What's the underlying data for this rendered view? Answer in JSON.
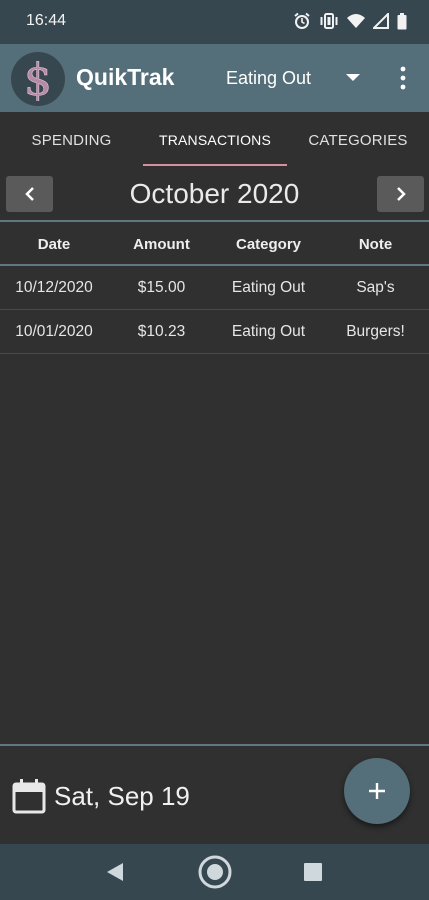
{
  "status_bar": {
    "time": "16:44"
  },
  "app_bar": {
    "title": "QuikTrak",
    "selected_category": "Eating Out"
  },
  "tabs": [
    {
      "label": "SPENDING",
      "active": false
    },
    {
      "label": "TRANSACTIONS",
      "active": true
    },
    {
      "label": "CATEGORIES",
      "active": false
    }
  ],
  "month_nav": {
    "month": "October 2020"
  },
  "table": {
    "columns": [
      "Date",
      "Amount",
      "Category",
      "Note"
    ],
    "rows": [
      [
        "10/12/2020",
        "$15.00",
        "Eating Out",
        "Sap's"
      ],
      [
        "10/01/2020",
        "$10.23",
        "Eating Out",
        "Burgers!"
      ]
    ]
  },
  "footer": {
    "date": "Sat, Sep 19",
    "add_label": "+"
  },
  "colors": {
    "app_bar": "#546e7a",
    "status_bar": "#37474f",
    "background": "#303030",
    "tab_indicator": "#d68f9c",
    "fab": "#546e7a"
  }
}
